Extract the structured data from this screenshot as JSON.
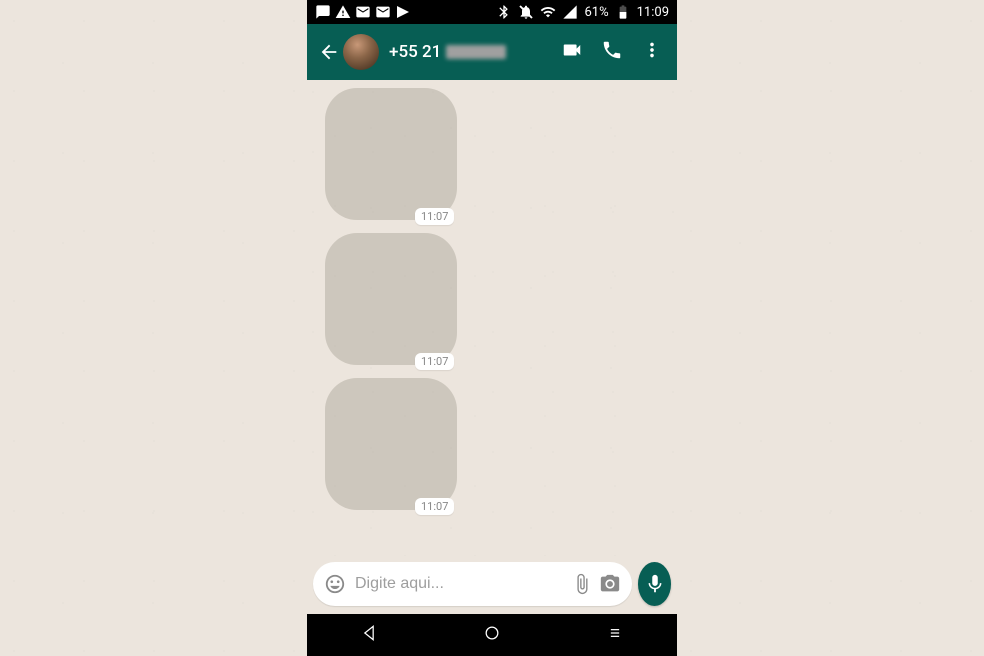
{
  "status_bar": {
    "battery_pct": "61%",
    "time": "11:09"
  },
  "header": {
    "contact_number_prefix": "+55 21"
  },
  "messages": [
    {
      "time": "11:07"
    },
    {
      "time": "11:07"
    },
    {
      "time": "11:07"
    }
  ],
  "input": {
    "placeholder": "Digite aqui..."
  },
  "colors": {
    "header_bg": "#075E54",
    "chat_bg": "#ECE5DD",
    "accent": "#075E54"
  }
}
